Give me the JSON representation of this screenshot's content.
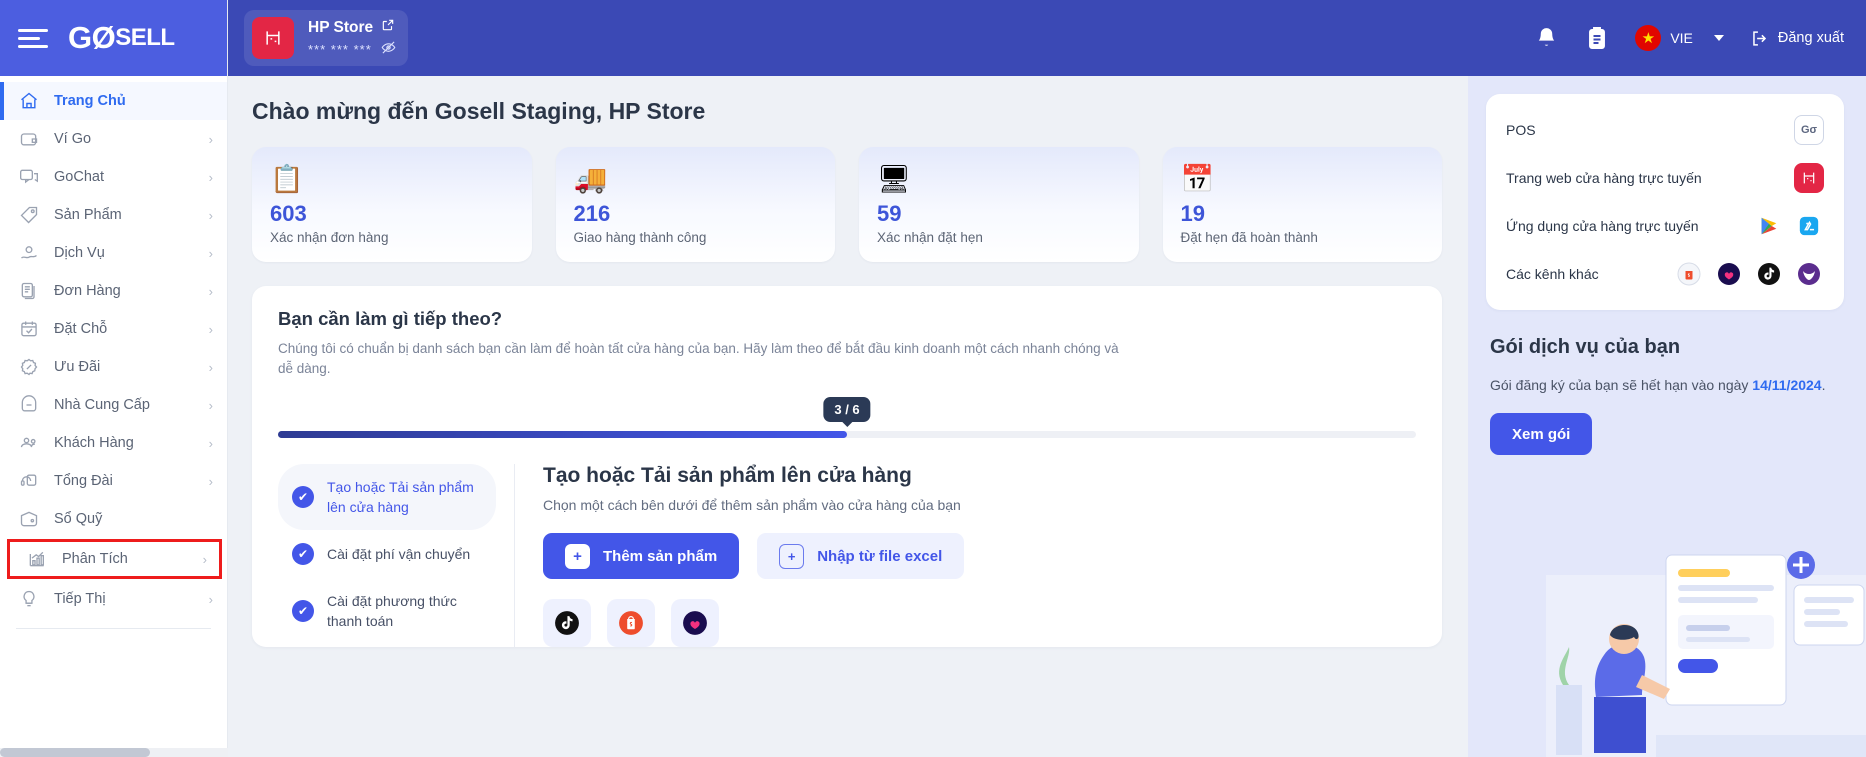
{
  "brand": {
    "logo_text": "GOSELL",
    "menu_icon": "hamburger-icon"
  },
  "sidebar": {
    "items": [
      {
        "label": "Trang Chủ",
        "icon": "home-icon",
        "active": true,
        "chevron": false
      },
      {
        "label": "Ví Go",
        "icon": "wallet-icon",
        "chevron": true
      },
      {
        "label": "GoChat",
        "icon": "chat-icon",
        "chevron": true
      },
      {
        "label": "Sản Phẩm",
        "icon": "tag-icon",
        "chevron": true
      },
      {
        "label": "Dịch Vụ",
        "icon": "service-icon",
        "chevron": true
      },
      {
        "label": "Đơn Hàng",
        "icon": "orders-icon",
        "chevron": true
      },
      {
        "label": "Đặt Chỗ",
        "icon": "calendar-check-icon",
        "chevron": true
      },
      {
        "label": "Ưu Đãi",
        "icon": "discount-icon",
        "chevron": true
      },
      {
        "label": "Nhà Cung Cấp",
        "icon": "supplier-icon",
        "chevron": true
      },
      {
        "label": "Khách Hàng",
        "icon": "customers-icon",
        "chevron": true
      },
      {
        "label": "Tổng Đài",
        "icon": "callcenter-icon",
        "chevron": true
      },
      {
        "label": "Sổ Quỹ",
        "icon": "cashbook-icon",
        "chevron": false
      },
      {
        "label": "Phân Tích",
        "icon": "analytics-icon",
        "chevron": true,
        "highlighted": true
      },
      {
        "label": "Tiếp Thị",
        "icon": "marketing-icon",
        "chevron": true
      }
    ]
  },
  "topbar": {
    "store_name": "HP Store",
    "store_phone_masked": "*** *** ***",
    "store_logo_icon": "store-logo-icon",
    "external_link_icon": "external-link-icon",
    "eye_off_icon": "eye-off-icon",
    "bell_icon": "bell-icon",
    "clipboard_icon": "clipboard-icon",
    "language": "VIE",
    "flag_icon": "vietnam-flag-icon",
    "logout_label": "Đăng xuất",
    "logout_icon": "logout-icon"
  },
  "main": {
    "welcome": "Chào mừng đến Gosell Staging, HP Store",
    "stats": [
      {
        "icon": "checklist-package-emoji",
        "glyph": "📋",
        "value": "603",
        "label": "Xác nhận đơn hàng"
      },
      {
        "icon": "delivery-truck-emoji",
        "glyph": "🚚",
        "value": "216",
        "label": "Giao hàng thành công"
      },
      {
        "icon": "monitor-booking-emoji",
        "glyph": "🖥",
        "value": "59",
        "label": "Xác nhận đặt hẹn"
      },
      {
        "icon": "calendar-done-emoji",
        "glyph": "📅",
        "value": "19",
        "label": "Đặt hẹn đã hoàn thành"
      }
    ],
    "panel": {
      "title": "Bạn cần làm gì tiếp theo?",
      "subtitle": "Chúng tôi có chuẩn bị danh sách bạn cần làm để hoàn tất cửa hàng của bạn. Hãy làm theo để bắt đầu kinh doanh một cách nhanh chóng và dễ dàng.",
      "progress_badge": "3 / 6",
      "progress_percent": 50,
      "steps": [
        {
          "label": "Tạo hoặc Tải sản phẩm lên cửa hàng",
          "done": true,
          "current": true
        },
        {
          "label": "Cài đặt phí vận chuyển",
          "done": true,
          "current": false
        },
        {
          "label": "Cài đặt phương thức thanh toán",
          "done": true,
          "current": false
        }
      ],
      "detail": {
        "title": "Tạo hoặc Tải sản phẩm lên cửa hàng",
        "subtitle": "Chọn một cách bên dưới để thêm sản phẩm vào cửa hàng của bạn",
        "primary_button": "Thêm sản phẩm",
        "primary_button_icon": "plus-icon",
        "secondary_button": "Nhập từ file excel",
        "secondary_button_icon": "file-import-icon",
        "channels": [
          {
            "name": "tiktok-icon",
            "glyph": "♪"
          },
          {
            "name": "shopee-icon",
            "glyph": "🛍"
          },
          {
            "name": "lazada-icon",
            "glyph": "♥"
          }
        ]
      }
    }
  },
  "rail": {
    "rows": [
      {
        "label": "POS",
        "icons": [
          {
            "name": "pos-badge-icon",
            "glyph": "Gσ",
            "style": "outline"
          }
        ]
      },
      {
        "label": "Trang web cửa hàng trực tuyến",
        "icons": [
          {
            "name": "store-web-icon",
            "glyph": "⛩",
            "style": "red"
          }
        ]
      },
      {
        "label": "Ứng dụng cửa hàng trực tuyến",
        "icons": [
          {
            "name": "google-play-icon",
            "glyph": "▶"
          },
          {
            "name": "app-store-icon",
            "glyph": ""
          }
        ]
      },
      {
        "label": "Các kênh khác",
        "icons": [
          {
            "name": "shopee-channel-icon",
            "glyph": "S"
          },
          {
            "name": "lazada-channel-icon",
            "glyph": "♥"
          },
          {
            "name": "tiktok-channel-icon",
            "glyph": "♪"
          },
          {
            "name": "sendo-channel-icon",
            "glyph": "✦"
          }
        ]
      }
    ],
    "package_title": "Gói dịch vụ của bạn",
    "expiry_prefix": "Gói đăng ký của bạn sẽ hết hạn vào ngày ",
    "expiry_date": "14/11/2024",
    "expiry_suffix": ".",
    "view_package_button": "Xem gói"
  },
  "colors": {
    "brand_blue": "#4c5ee0",
    "topbar_blue": "#3b49b5",
    "accent": "#4356e8",
    "link": "#2f6bf0",
    "highlight_red": "#ee1c1c",
    "rail_bg": "#e3e7fa"
  }
}
